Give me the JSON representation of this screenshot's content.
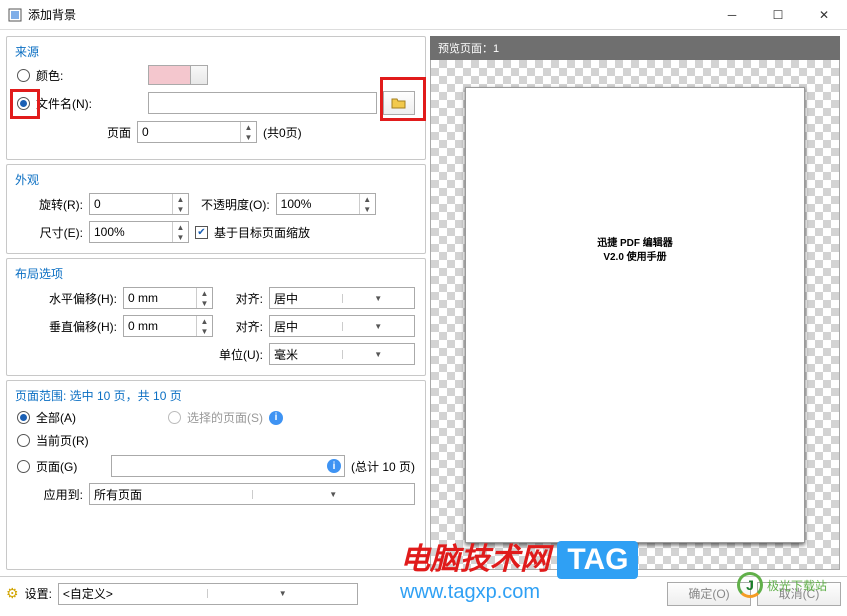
{
  "titlebar": {
    "title": "添加背景"
  },
  "source": {
    "title": "来源",
    "radio_color_label": "颜色:",
    "radio_filename_label": "文件名(N):",
    "filename_value": "",
    "page_label": "页面",
    "page_value": "0",
    "page_total": "(共0页)"
  },
  "appearance": {
    "title": "外观",
    "rotate_label": "旋转(R):",
    "rotate_value": "0",
    "opacity_label": "不透明度(O):",
    "opacity_value": "100%",
    "size_label": "尺寸(E):",
    "size_value": "100%",
    "scale_checkbox_label": "基于目标页面缩放"
  },
  "layout": {
    "title": "布局选项",
    "hoffset_label": "水平偏移(H):",
    "hoffset_value": "0 mm",
    "halign_label": "对齐:",
    "halign_value": "居中",
    "voffset_label": "垂直偏移(H):",
    "voffset_value": "0 mm",
    "valign_label": "对齐:",
    "valign_value": "居中",
    "unit_label": "单位(U):",
    "unit_value": "毫米"
  },
  "range": {
    "title": "页面范围: 选中 10 页，共 10 页",
    "radio_all_label": "全部(A)",
    "radio_selected_label": "选择的页面(S)",
    "radio_current_label": "当前页(R)",
    "radio_pages_label": "页面(G)",
    "pages_value": "",
    "total_label": "(总计 10 页)",
    "apply_label": "应用到:",
    "apply_value": "所有页面"
  },
  "preview": {
    "title": "预览页面：1",
    "page_title1": "迅捷 PDF 编辑器",
    "page_title2": "V2.0 使用手册"
  },
  "bottom": {
    "settings_label": "设置:",
    "settings_value": "<自定义>",
    "ok_label": "确定(O)",
    "cancel_label": "取消(C)"
  },
  "watermark": {
    "line1": "电脑技术网",
    "tag": "TAG",
    "line2": "www.tagxp.com",
    "site": "极光下载站"
  }
}
